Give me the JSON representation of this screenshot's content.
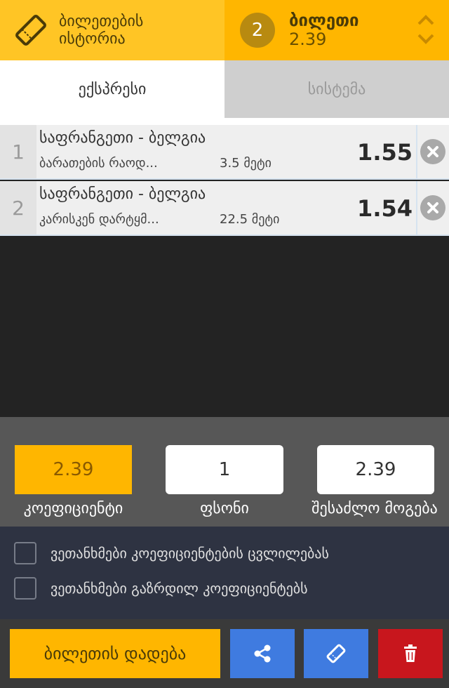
{
  "header": {
    "history_line1": "ბილეთების",
    "history_line2": "ისტორია",
    "ticket_count": "2",
    "ticket_label": "ბილეთი",
    "ticket_total": "2.39"
  },
  "tabs": [
    {
      "label": "ექსპრესი",
      "active": true
    },
    {
      "label": "სისტემა",
      "active": false
    }
  ],
  "bets": [
    {
      "num": "1",
      "match": "საფრანგეთი - ბელგია",
      "market": "ბარათების რაოდ...",
      "outcome": "3.5 მეტი",
      "odds": "1.55"
    },
    {
      "num": "2",
      "match": "საფრანგეთი - ბელგია",
      "market": "კარისკენ დარტყმ...",
      "outcome": "22.5 მეტი",
      "odds": "1.54"
    }
  ],
  "summary": {
    "odds_value": "2.39",
    "odds_label": "კოეფიციენტი",
    "stake_value": "1",
    "stake_label": "ფსონი",
    "win_value": "2.39",
    "win_label": "შესაძლო მოგება"
  },
  "options": [
    {
      "label": "ვეთანხმები კოეფიციენტების ცვლილებას",
      "checked": false
    },
    {
      "label": "ვეთანხმები გაზრდილ კოეფიციენტებს",
      "checked": false
    }
  ],
  "actions": {
    "place_bet_label": "ბილეთის დადება"
  },
  "colors": {
    "accent": "#FFB600",
    "blue": "#3F7BE0",
    "red": "#C8161D"
  }
}
